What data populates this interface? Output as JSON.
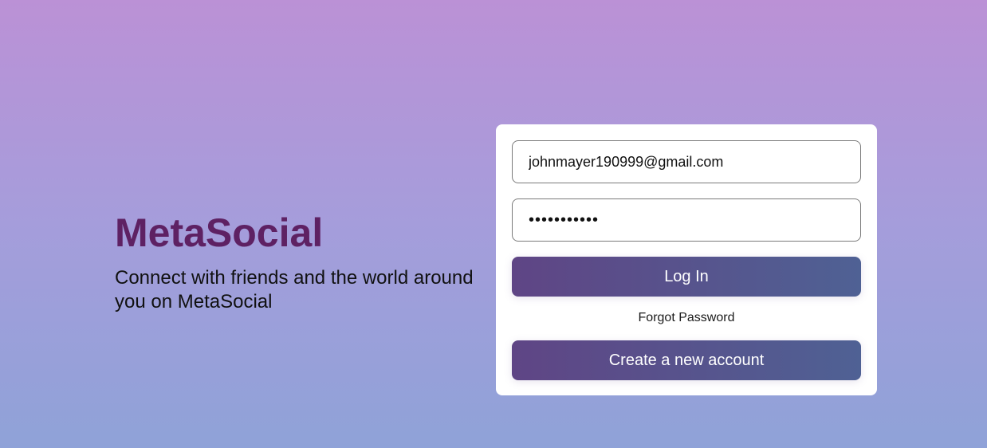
{
  "brand": {
    "title": "MetaSocial",
    "tagline": "Connect with friends and the world around you on MetaSocial"
  },
  "login": {
    "email_value": "johnmayer190999@gmail.com",
    "password_value": "•••••••••••",
    "login_label": "Log In",
    "forgot_label": "Forgot Password",
    "create_label": "Create a new account"
  },
  "colors": {
    "brand_title": "#5e2163",
    "button_start": "#5f4585",
    "button_end": "#4f6194",
    "background_top": "#bb91d6",
    "background_bottom": "#8fa2d8"
  }
}
